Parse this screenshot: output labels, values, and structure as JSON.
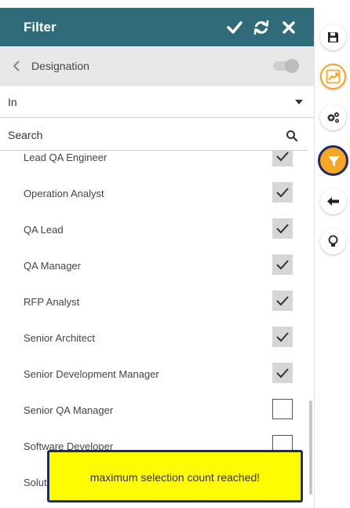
{
  "header": {
    "title": "Filter",
    "apply_icon": "check-icon",
    "reset_icon": "refresh-icon",
    "close_icon": "close-icon",
    "color": "#2f6b79"
  },
  "field": {
    "label": "Designation",
    "back_icon": "chevron-left-icon"
  },
  "operator": {
    "selected": "In"
  },
  "search": {
    "placeholder": "Search",
    "value": ""
  },
  "items": [
    {
      "label": "Lead QA Engineer",
      "checked": true
    },
    {
      "label": "Operation Analyst",
      "checked": true
    },
    {
      "label": "QA Lead",
      "checked": true
    },
    {
      "label": "QA Manager",
      "checked": true
    },
    {
      "label": "RFP Analyst",
      "checked": true
    },
    {
      "label": "Senior Architect",
      "checked": true
    },
    {
      "label": "Senior Development Manager",
      "checked": true
    },
    {
      "label": "Senior QA Manager",
      "checked": false
    },
    {
      "label": "Software Developer",
      "checked": false
    },
    {
      "label": "Solut",
      "checked": false
    }
  ],
  "toast": {
    "message": "maximum selection count reached!",
    "color": "#fffb00"
  },
  "rail": [
    {
      "name": "save-icon"
    },
    {
      "name": "chart-icon"
    },
    {
      "name": "gears-icon"
    },
    {
      "name": "filter-icon",
      "active": true,
      "color": "#f5a623"
    },
    {
      "name": "arrow-left-icon"
    },
    {
      "name": "lightbulb-icon"
    }
  ]
}
